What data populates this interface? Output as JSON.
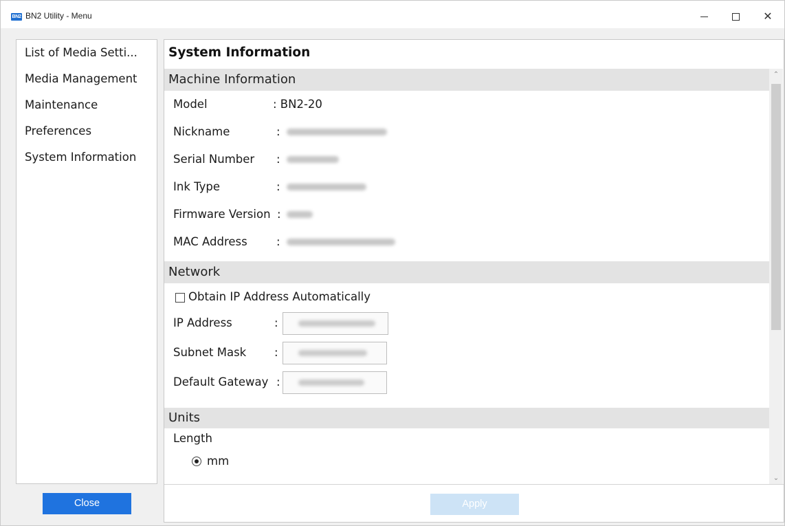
{
  "window": {
    "title": "BN2 Utility - Menu",
    "icon_text": "BN2",
    "accent_color": "#1f73df"
  },
  "sidebar": {
    "items": [
      {
        "label": "List of Media Setti..."
      },
      {
        "label": "Media Management"
      },
      {
        "label": "Maintenance"
      },
      {
        "label": "Preferences"
      },
      {
        "label": "System Information"
      }
    ],
    "close_label": "Close"
  },
  "main": {
    "title": "System Information",
    "machine": {
      "header": "Machine Information",
      "model_label": "Model",
      "model_value": ": BN2-20",
      "nickname_label": "Nickname",
      "serial_label": "Serial Number",
      "ink_label": "Ink Type",
      "firmware_label": "Firmware Version",
      "mac_label": "MAC Address",
      "colon": ":"
    },
    "network": {
      "header": "Network",
      "obtain_ip_label": "Obtain IP Address Automatically",
      "obtain_ip_checked": false,
      "ip_label": "IP Address",
      "subnet_label": "Subnet Mask",
      "gateway_label": "Default Gateway",
      "colon": ":"
    },
    "units": {
      "header": "Units",
      "length_label": "Length",
      "length_option": "mm",
      "length_selected": true
    },
    "apply_label": "Apply"
  }
}
